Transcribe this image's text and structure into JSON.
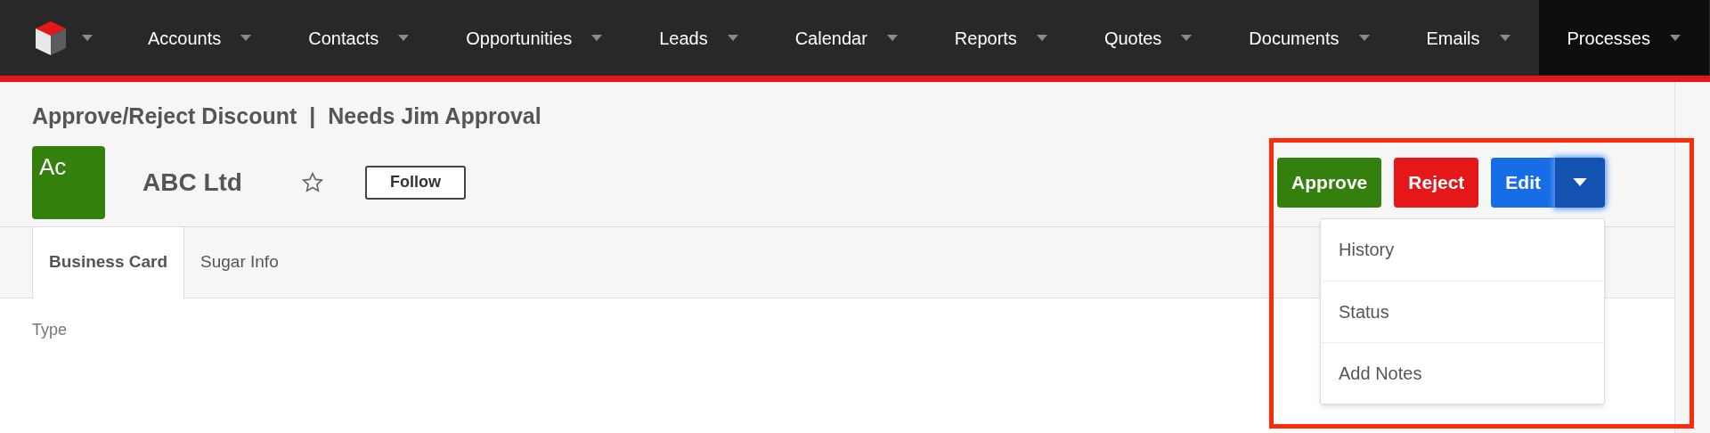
{
  "nav": {
    "items": [
      {
        "label": "Accounts",
        "selected": false
      },
      {
        "label": "Contacts",
        "selected": false
      },
      {
        "label": "Opportunities",
        "selected": false
      },
      {
        "label": "Leads",
        "selected": false
      },
      {
        "label": "Calendar",
        "selected": false
      },
      {
        "label": "Reports",
        "selected": false
      },
      {
        "label": "Quotes",
        "selected": false
      },
      {
        "label": "Documents",
        "selected": false
      },
      {
        "label": "Emails",
        "selected": false
      },
      {
        "label": "Processes",
        "selected": true
      }
    ]
  },
  "header": {
    "title": "Approve/Reject Discount",
    "separator": "|",
    "subtitle": "Needs Jim Approval"
  },
  "record": {
    "avatar": "Ac",
    "name": "ABC Ltd",
    "favorite": false,
    "follow": "Follow"
  },
  "actions": [
    {
      "label": "Approve",
      "kind": "approve"
    },
    {
      "label": "Reject",
      "kind": "reject"
    },
    {
      "label": "Edit",
      "kind": "edit"
    }
  ],
  "action_menu": {
    "expanded": true,
    "items": [
      "History",
      "Status",
      "Add Notes"
    ]
  },
  "tabs": [
    {
      "label": "Business Card",
      "selected": true
    },
    {
      "label": "Sugar Info",
      "selected": false
    }
  ],
  "fields": [
    {
      "label": "Type"
    }
  ]
}
